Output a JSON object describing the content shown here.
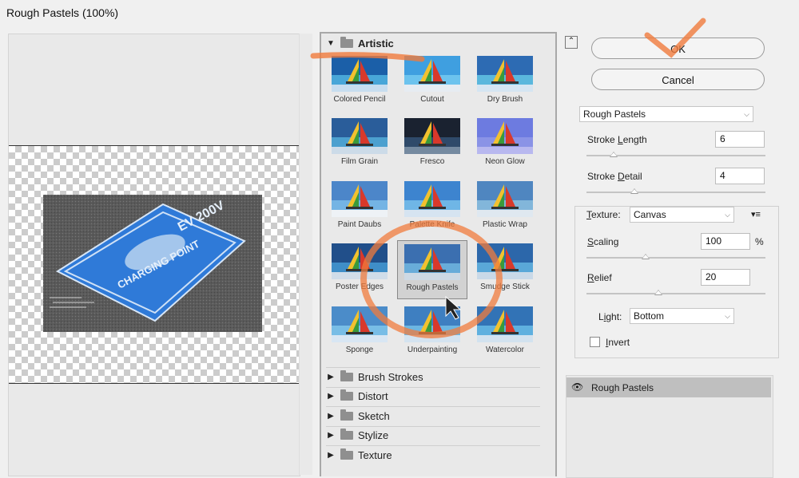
{
  "window": {
    "title": "Rough Pastels (100%)"
  },
  "preview": {
    "sign_line1": "EV 200V",
    "sign_line2": "CHARGING POINT"
  },
  "gallery": {
    "open_category": "Artistic",
    "thumbnails": [
      {
        "label": "Colored Pencil"
      },
      {
        "label": "Cutout"
      },
      {
        "label": "Dry Brush"
      },
      {
        "label": "Film Grain"
      },
      {
        "label": "Fresco"
      },
      {
        "label": "Neon Glow"
      },
      {
        "label": "Paint Daubs"
      },
      {
        "label": "Palette Knife"
      },
      {
        "label": "Plastic Wrap"
      },
      {
        "label": "Poster Edges"
      },
      {
        "label": "Rough Pastels"
      },
      {
        "label": "Smudge Stick"
      },
      {
        "label": "Sponge"
      },
      {
        "label": "Underpainting"
      },
      {
        "label": "Watercolor"
      }
    ],
    "selected": "Rough Pastels",
    "categories": [
      {
        "label": "Brush Strokes"
      },
      {
        "label": "Distort"
      },
      {
        "label": "Sketch"
      },
      {
        "label": "Stylize"
      },
      {
        "label": "Texture"
      }
    ]
  },
  "buttons": {
    "ok": "OK",
    "cancel": "Cancel"
  },
  "filter": {
    "select": "Rough Pastels"
  },
  "params": {
    "stroke_length": {
      "label_a": "Stroke ",
      "label_u": "L",
      "label_b": "ength",
      "value": "6",
      "fraction": 0.15
    },
    "stroke_detail": {
      "label_a": "Stroke ",
      "label_u": "D",
      "label_b": "etail",
      "value": "4",
      "fraction": 0.27
    }
  },
  "texture": {
    "label_u": "T",
    "label_b": "exture:",
    "value": "Canvas",
    "scaling": {
      "label_u": "S",
      "label_b": "caling",
      "value": "100",
      "unit": "%",
      "fraction": 0.33
    },
    "relief": {
      "label_u": "R",
      "label_b": "elief",
      "value": "20",
      "fraction": 0.4
    },
    "light": {
      "label_a": "L",
      "label_u": "i",
      "label_b": "ght:",
      "value": "Bottom"
    },
    "invert": {
      "label_u": "I",
      "label_b": "nvert",
      "checked": false
    }
  },
  "layers": {
    "items": [
      {
        "name": "Rough Pastels",
        "visible": true
      }
    ]
  },
  "colors": {
    "sign_blue": "#2f7ad8",
    "annotation_orange": "#f07b3c"
  }
}
